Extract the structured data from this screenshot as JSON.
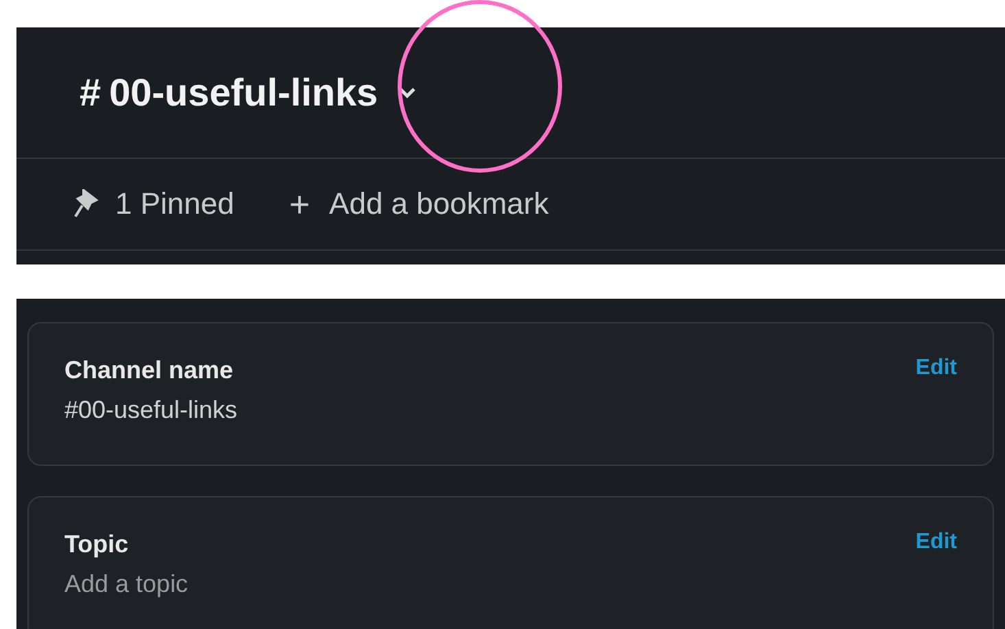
{
  "header": {
    "channel_prefix": "#",
    "channel_name": "00-useful-links"
  },
  "bookmarks_bar": {
    "pinned": "1 Pinned",
    "add_symbol": "+",
    "add_label": "Add a bookmark"
  },
  "details": [
    {
      "label": "Channel name",
      "value": "#00-useful-links",
      "action": "Edit",
      "kind": "value"
    },
    {
      "label": "Topic",
      "value": "Add a topic",
      "action": "Edit",
      "kind": "empty"
    }
  ]
}
